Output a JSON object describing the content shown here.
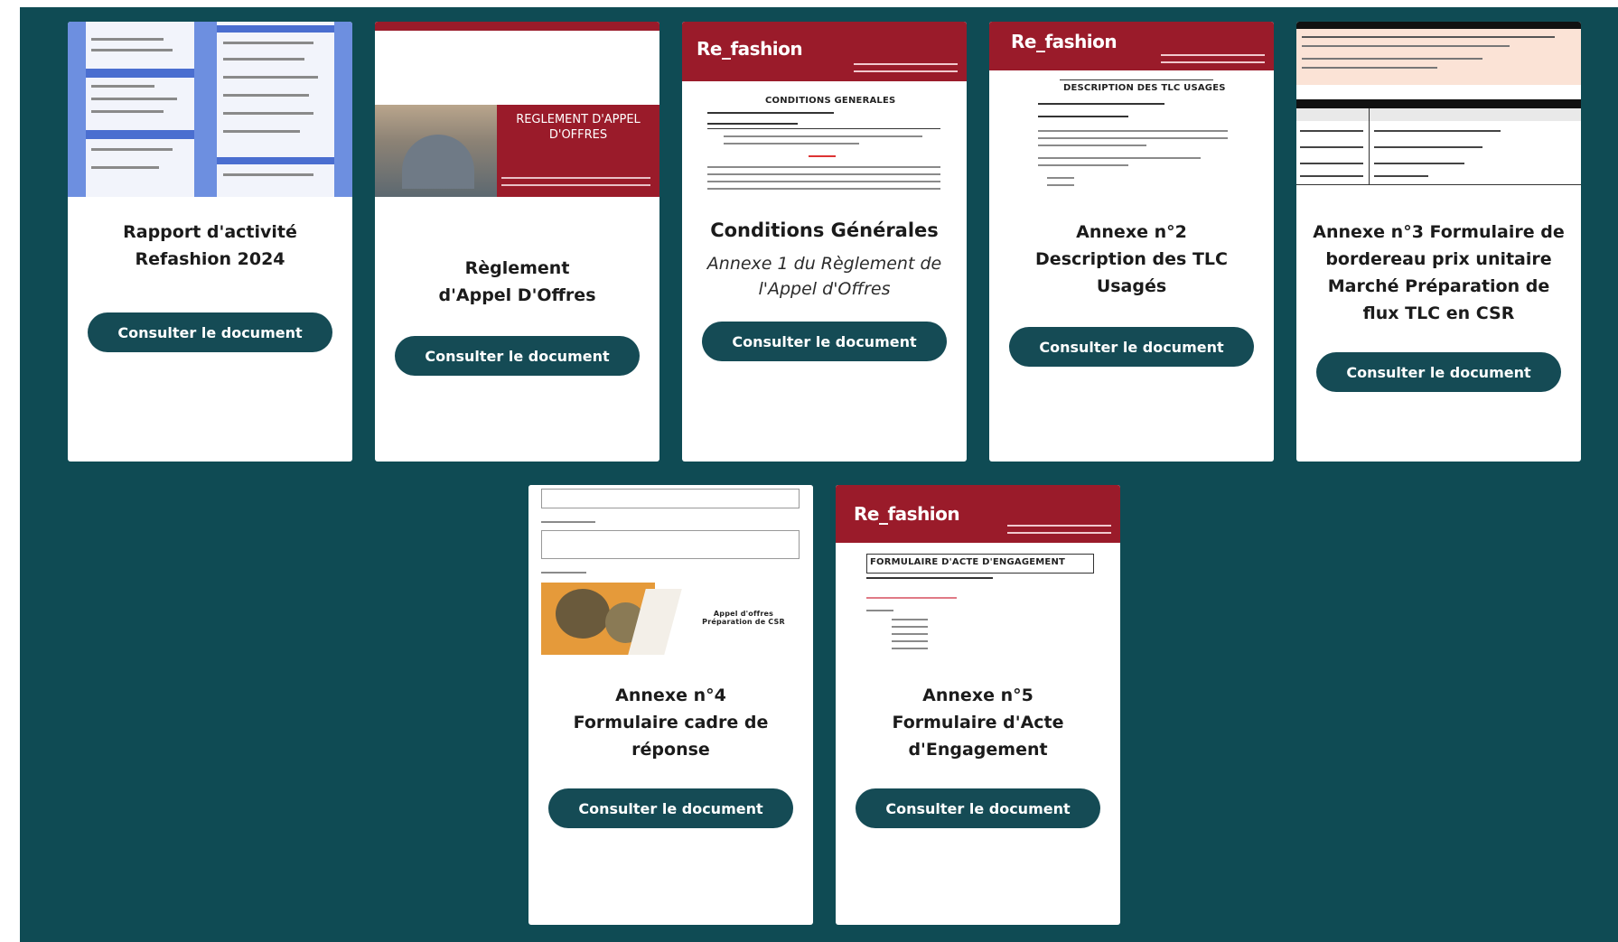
{
  "button_label": "Consulter le document",
  "cards": [
    {
      "title": "Rapport d'activité Refashion 2024",
      "subtitle": "",
      "thumb": "activity-report"
    },
    {
      "title": "Règlement d'Appel D'Offres",
      "subtitle": "",
      "thumb": "reglement",
      "thumb_heading": "REGLEMENT D'APPEL D'OFFRES"
    },
    {
      "title": "Conditions Générales",
      "subtitle": "Annexe 1 du Règlement de l'Appel d'Offres",
      "thumb": "conditions",
      "thumb_logo": "Re_fashion",
      "thumb_heading": "CONDITIONS GENERALES"
    },
    {
      "title": "Annexe n°2 Description des TLC Usagés",
      "subtitle": "",
      "thumb": "description",
      "thumb_logo": "Re_fashion",
      "thumb_heading": "DESCRIPTION DES TLC USAGES"
    },
    {
      "title": "Annexe n°3 Formulaire de bordereau prix unitaire Marché Préparation de flux TLC en CSR",
      "subtitle": "",
      "thumb": "spreadsheet"
    },
    {
      "title": "Annexe n°4 Formulaire cadre de réponse",
      "subtitle": "",
      "thumb": "form",
      "thumb_heading": "Appel d'offres Préparation de CSR"
    },
    {
      "title": "Annexe n°5 Formulaire d'Acte d'Engagement",
      "subtitle": "",
      "thumb": "engagement",
      "thumb_logo": "Re_fashion",
      "thumb_heading": "FORMULAIRE D'ACTE D'ENGAGEMENT"
    }
  ],
  "colors": {
    "background": "#0f4b54",
    "button": "#154b55",
    "brand_red": "#9a1b2a"
  }
}
